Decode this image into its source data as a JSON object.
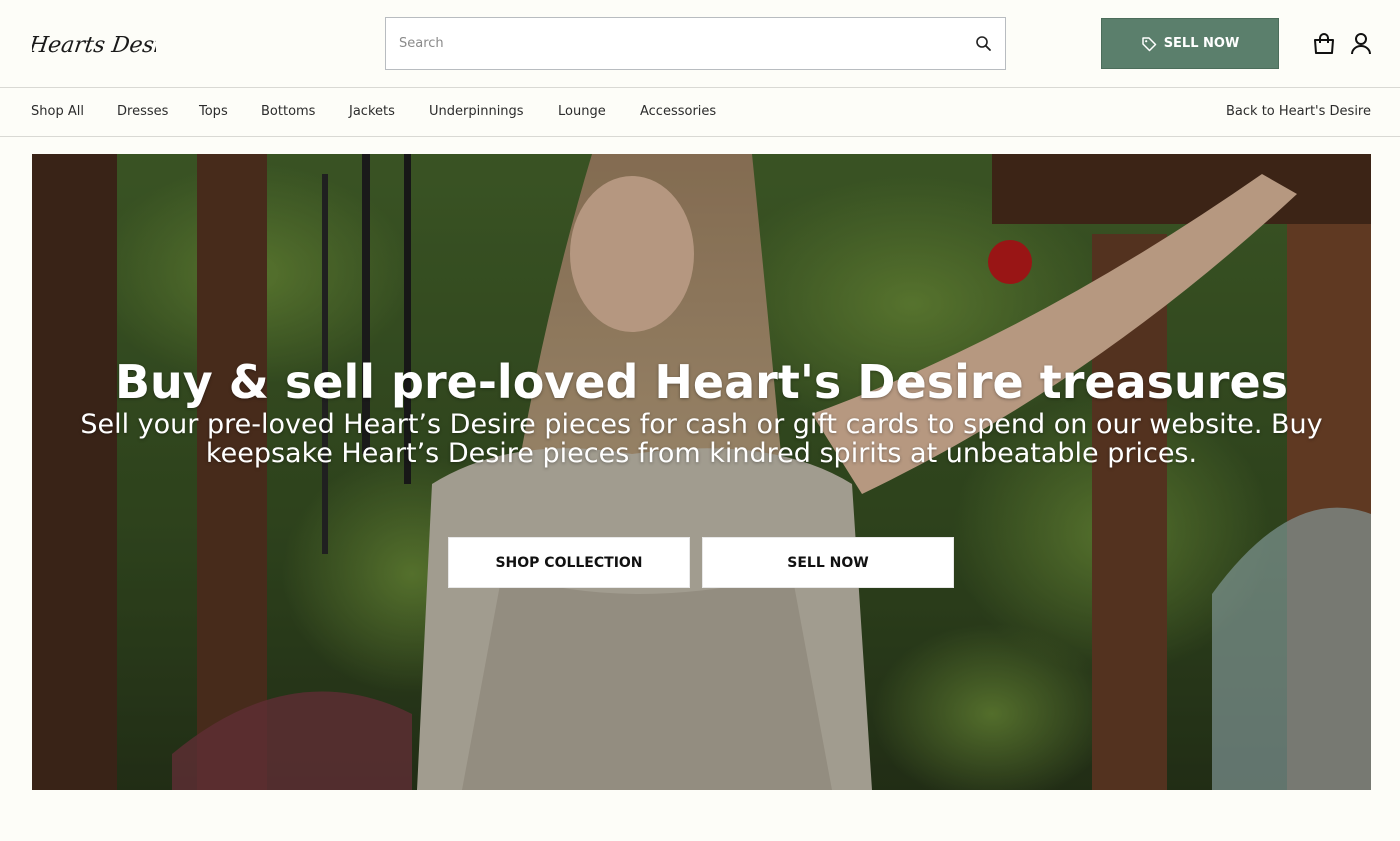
{
  "brand": {
    "logo_text": "Hearts Desire"
  },
  "search": {
    "placeholder": "Search",
    "value": ""
  },
  "header": {
    "sell_label": "SELL NOW"
  },
  "nav": {
    "items": [
      "Shop All",
      "Dresses",
      "Tops",
      "Bottoms",
      "Jackets",
      "Underpinnings",
      "Lounge",
      "Accessories"
    ],
    "back_label": "Back to Heart's Desire"
  },
  "hero": {
    "title": "Buy & sell pre-loved Heart's Desire treasures",
    "subtitle": "Sell your pre-loved Heart’s Desire pieces for cash or gift cards to spend on our website. Buy keepsake Heart’s Desire pieces from kindred spirits at unbeatable prices.",
    "shop_label": "SHOP COLLECTION",
    "sell_label": "SELL NOW"
  },
  "colors": {
    "accent": "#5b7f6c",
    "background": "#fdfdf8"
  },
  "icons": [
    "search-icon",
    "tag-icon",
    "shopping-bag-icon",
    "user-icon"
  ]
}
